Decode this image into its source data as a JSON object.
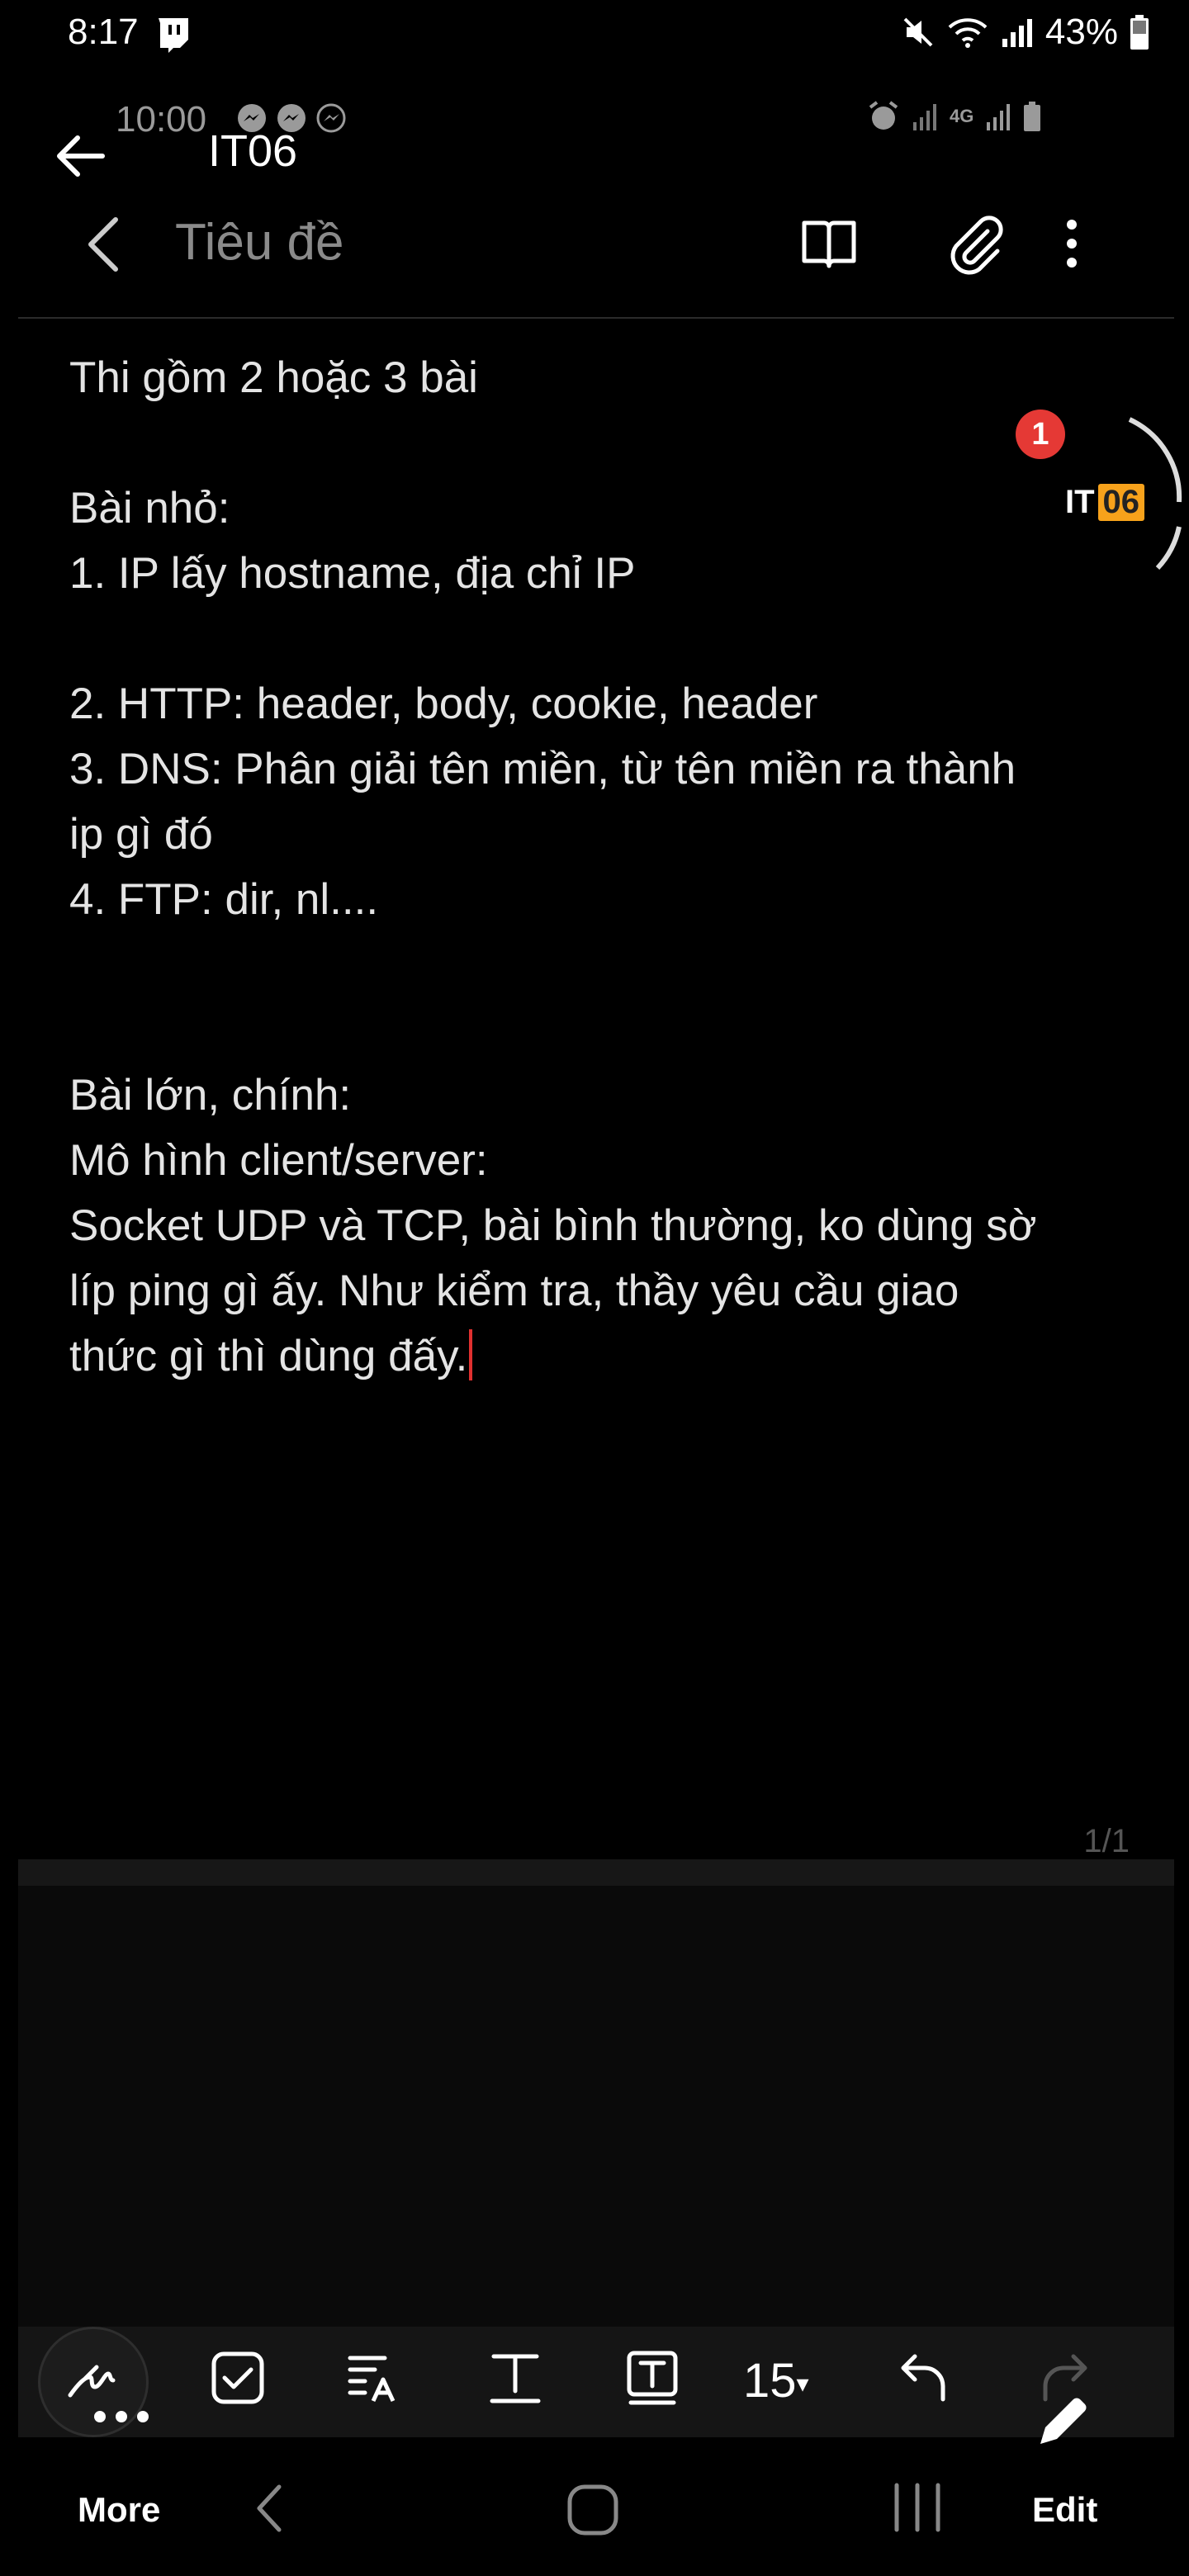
{
  "status_bar": {
    "time": "8:17",
    "battery": "43%"
  },
  "inner_status": {
    "time": "10:00",
    "network": "4G"
  },
  "app_header": {
    "title": "IT06"
  },
  "note_toolbar": {
    "title_placeholder": "Tiêu đề"
  },
  "note": {
    "lines": [
      "Thi gồm 2 hoặc 3 bài",
      "",
      "Bài nhỏ:",
      "1. IP lấy hostname, địa chỉ IP",
      "",
      "2. HTTP: header, body, cookie, header",
      "3. DNS: Phân giải tên miền, từ tên miền ra thành",
      "ip gì đó",
      "4. FTP: dir, nl....",
      "",
      "",
      "Bài lớn, chính:",
      "Mô hình client/server:",
      "Socket UDP và TCP, bài bình thường, ko dùng sờ",
      "líp ping gì ấy. Như kiểm tra, thầy yêu cầu giao",
      "thức gì thì dùng đấy."
    ]
  },
  "bubble": {
    "badge_count": "1",
    "label_it": "IT",
    "label_num": "06",
    "accent": "#f7a21b",
    "badge_color": "#e53935"
  },
  "page_counter": "1/1",
  "format_toolbar": {
    "font_size": "15"
  },
  "bottom_nav": {
    "more_label": "More",
    "edit_label": "Edit"
  },
  "icons": [
    "twitch-icon",
    "mute-icon",
    "wifi-icon",
    "signal-icon",
    "battery-icon",
    "messenger-icon",
    "alarm-icon",
    "back-arrow-icon",
    "chevron-left-icon",
    "reader-mode-icon",
    "paperclip-icon",
    "more-vert-icon",
    "handwriting-icon",
    "checkbox-icon",
    "text-style-icon",
    "text-format-icon",
    "text-box-icon",
    "undo-icon",
    "redo-icon",
    "pencil-icon",
    "nav-back-icon",
    "nav-home-icon",
    "nav-recents-icon"
  ]
}
